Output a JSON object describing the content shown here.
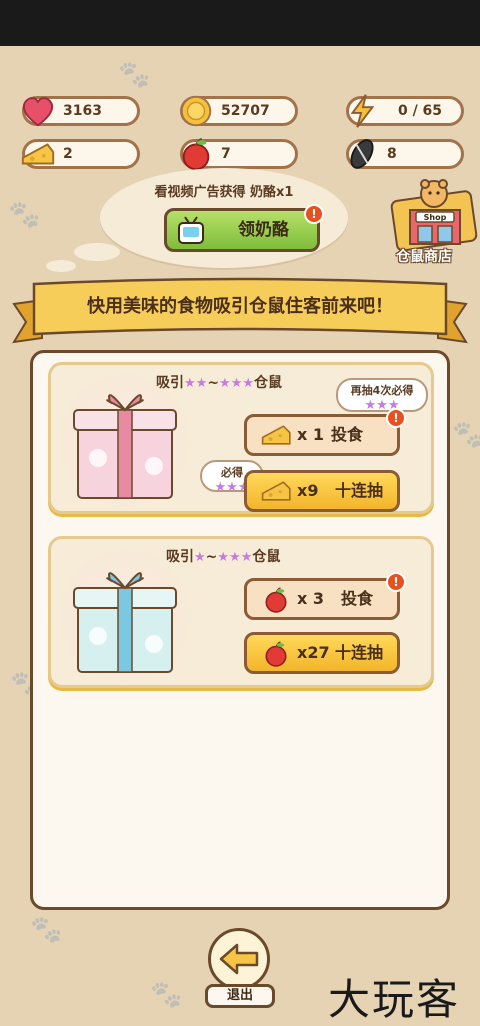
{
  "stats": {
    "hearts": "3163",
    "coins": "52707",
    "energy": "0 / 65",
    "cheese": "2",
    "apples": "7",
    "seeds": "8"
  },
  "ad": {
    "text": "看视频广告获得  奶酪x1",
    "button": "领奶酪",
    "badge": "!"
  },
  "shop": {
    "label": "仓鼠商店",
    "sign": "Shop"
  },
  "banner": {
    "text": "快用美味的食物吸引仓鼠住客前来吧！"
  },
  "card1": {
    "title_prefix": "吸引",
    "stars_low": "★★",
    "tilde": "~",
    "stars_high": "★★★",
    "title_suffix": "仓鼠",
    "hint": "再抽4次必得",
    "hint_stars": "★★★",
    "guarantee": "必得",
    "guarantee_stars": "★★★",
    "btn1_qty": "x 1",
    "btn1_label": "投食",
    "btn2_qty": "x9",
    "btn2_label": "十连抽"
  },
  "card2": {
    "title_prefix": "吸引",
    "stars_low": "★",
    "tilde": "~",
    "stars_high": "★★★",
    "title_suffix": "仓鼠",
    "btn1_qty": "x 3",
    "btn1_label": "投食",
    "btn2_qty": "x27",
    "btn2_label": "十连抽"
  },
  "exit": {
    "label": "退出"
  },
  "watermark": "大玩客",
  "colors": {
    "accent": "#f3b52b",
    "green": "#7fbd3a",
    "border": "#6b4a2c",
    "star": "#c77ae0"
  }
}
